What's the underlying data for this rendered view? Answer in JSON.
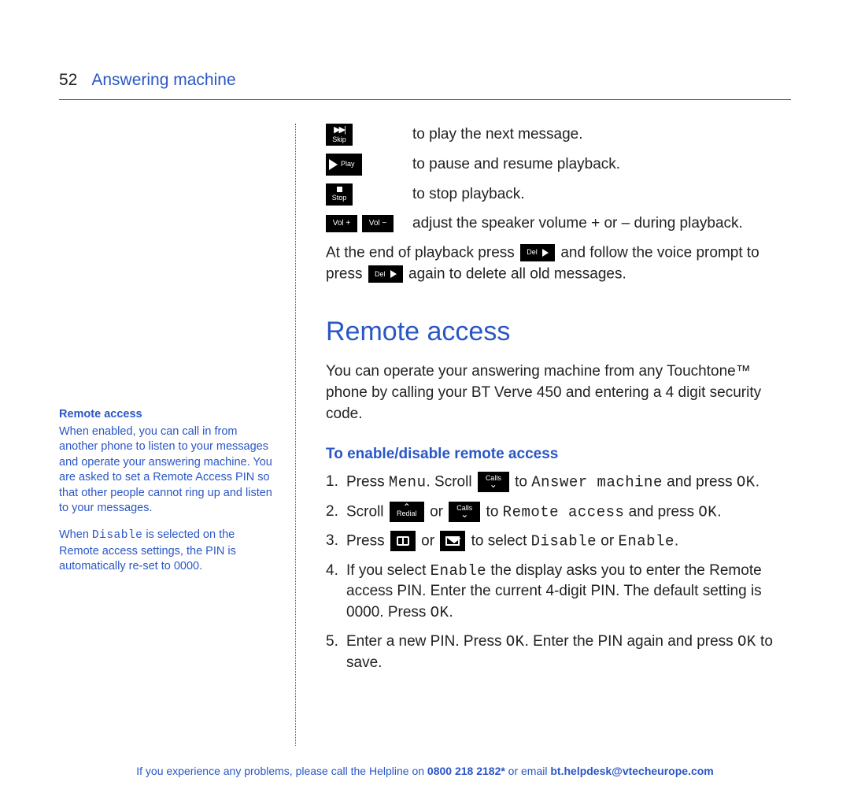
{
  "header": {
    "page_number": "52",
    "section": "Answering machine"
  },
  "sidebar": {
    "heading": "Remote access",
    "p1": "When enabled, you can call in from another phone to listen to your messages and operate your answering machine. You are asked to set a Remote Access PIN so that other people cannot ring up and listen to your messages.",
    "p2a": "When ",
    "p2_mono": "Disable",
    "p2b": " is selected on the Remote access settings, the PIN is automatically re-set to 0000."
  },
  "playback": {
    "skip_label": "Skip",
    "skip_text": "to play the next message.",
    "play_label": "Play",
    "play_text": "to pause and resume playback.",
    "stop_label": "Stop",
    "stop_text": "to stop playback.",
    "volp_label": "Vol +",
    "volm_label": "Vol −",
    "vol_text": "adjust the speaker volume + or – during playback.",
    "end1": "At the end of playback press ",
    "del_label": "Del",
    "end2": " and follow the voice prompt to press ",
    "end3": " again to delete all old messages."
  },
  "remote": {
    "heading": "Remote access",
    "intro": "You can operate your answering machine from any Touchtone™ phone by calling your BT Verve 450 and entering a 4 digit security code.",
    "sub": "To enable/disable remote access",
    "calls_label": "Calls",
    "redial_label": "Redial",
    "step1a": "Press ",
    "step1_menu": "Menu",
    "step1b": ". Scroll ",
    "step1c": " to ",
    "step1_ans": "Answer machine",
    "step1d": " and press ",
    "step1_ok": "OK",
    "step1e": ".",
    "step2a": "Scroll ",
    "step2b": " or ",
    "step2c": " to ",
    "step2_ra": "Remote access",
    "step2d": " and press ",
    "step2e": ".",
    "step3a": "Press ",
    "step3b": " or ",
    "step3c": " to select ",
    "step3_dis": "Disable",
    "step3d": " or ",
    "step3_en": "Enable",
    "step3e": ".",
    "step4a": "If you select ",
    "step4b": " the display asks you to enter the Remote access PIN. Enter the current 4-digit PIN. The default setting is 0000. Press ",
    "step4c": ".",
    "step5a": "Enter a new PIN. Press ",
    "step5b": ". Enter the PIN again and press ",
    "step5c": " to save."
  },
  "footer": {
    "t1": "If you experience any problems, please call the Helpline on ",
    "phone": "0800 218 2182*",
    "t2": " or email ",
    "email": "bt.helpdesk@vtecheurope.com"
  }
}
